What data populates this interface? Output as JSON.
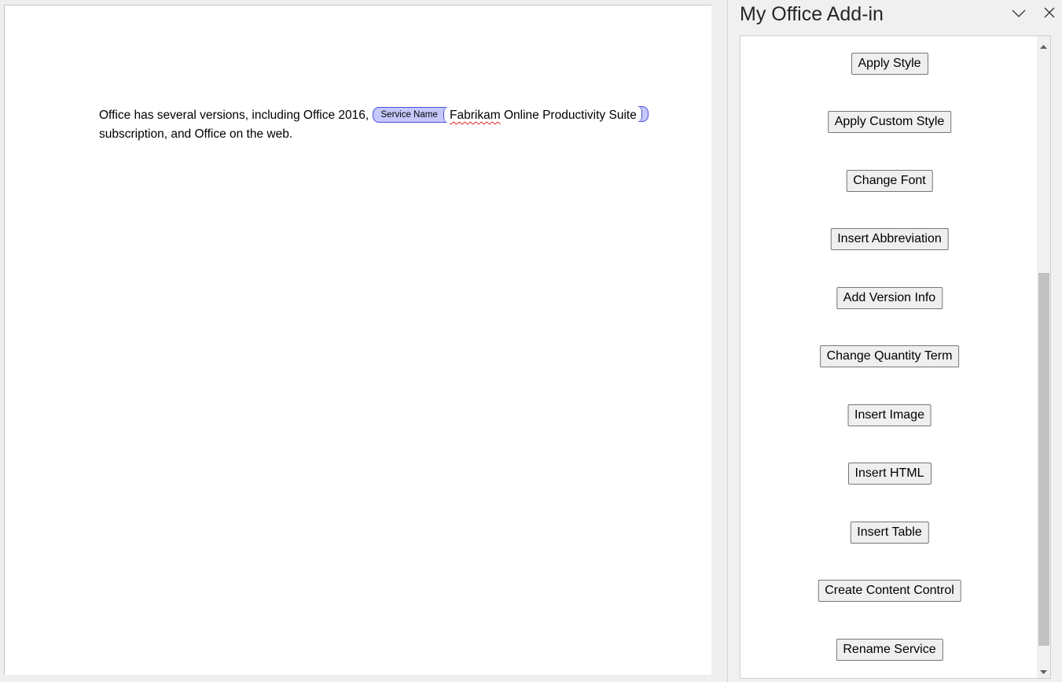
{
  "document": {
    "text_before": "Office has several versions, including Office 2016, ",
    "content_control": {
      "tag_title": "Service Name",
      "text_misspelled": "Fabrikam",
      "text_rest": " Online Productivity Suite"
    },
    "text_after": "subscription, and Office on the web.",
    "content_control_color": "#c5c8fb",
    "content_control_border": "#4b4fd6"
  },
  "task_pane": {
    "title": "My Office Add-in",
    "collapse_icon": "chevron-down-icon",
    "close_icon": "close-icon",
    "buttons": [
      {
        "label": "Apply Style"
      },
      {
        "label": "Apply Custom Style"
      },
      {
        "label": "Change Font"
      },
      {
        "label": "Insert Abbreviation"
      },
      {
        "label": "Add Version Info"
      },
      {
        "label": "Change Quantity Term"
      },
      {
        "label": "Insert Image"
      },
      {
        "label": "Insert HTML"
      },
      {
        "label": "Insert Table"
      },
      {
        "label": "Create Content Control"
      },
      {
        "label": "Rename Service"
      }
    ],
    "scroll": {
      "thumb_start_fraction": 0.37,
      "thumb_visible_fraction": 0.59
    }
  }
}
